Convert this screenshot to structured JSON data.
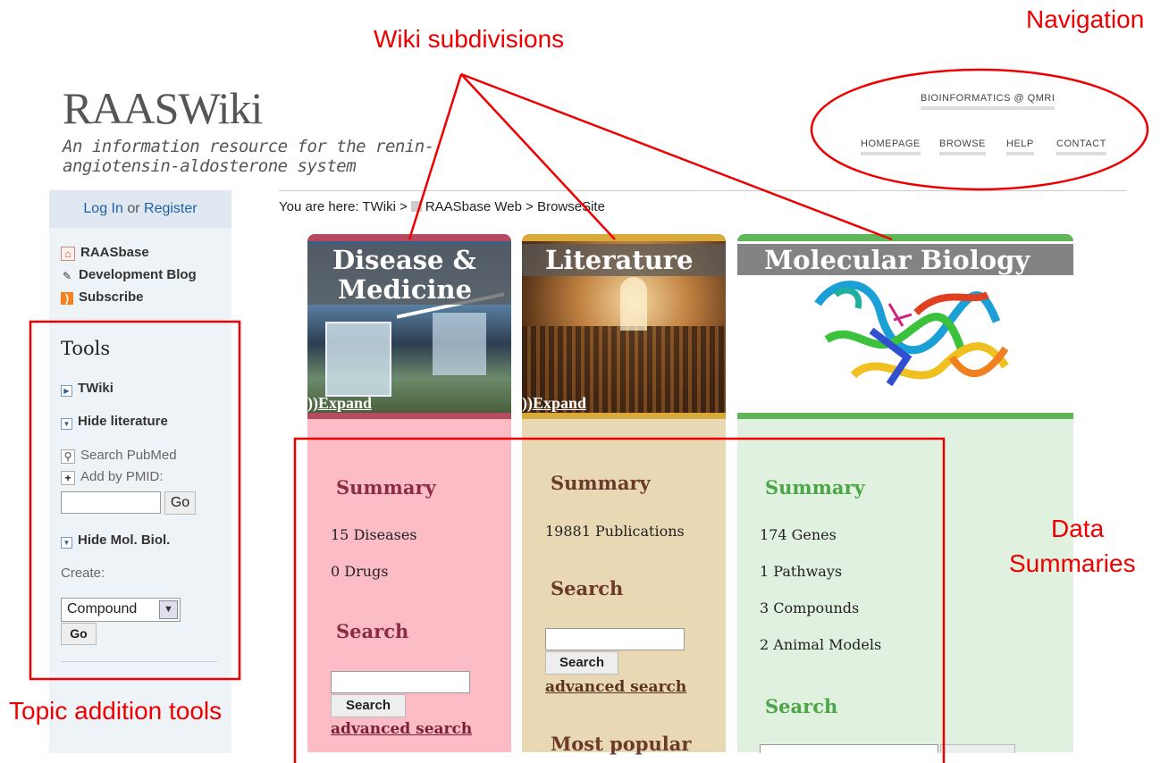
{
  "annotations": {
    "wiki_subdivisions": "Wiki subdivisions",
    "navigation": "Navigation",
    "data_summaries_line1": "Data",
    "data_summaries_line2": "Summaries",
    "topic_addition_tools": "Topic addition tools"
  },
  "colors": {
    "annotation": "#e00000",
    "link": "#1f5fa8"
  },
  "header": {
    "logo": "RAASWiki",
    "tagline": "An information resource for the renin-angiotensin-aldosterone system"
  },
  "nav": {
    "org": "BIOINFORMATICS @ QMRI",
    "items": [
      "HOMEPAGE",
      "BROWSE",
      "HELP",
      "CONTACT"
    ]
  },
  "breadcrumb": {
    "prefix": "You are here: TWiki >",
    "web": "RAASbase Web",
    "sep": ">",
    "page": "BrowseSite"
  },
  "sidebar": {
    "login": "Log In",
    "or": "or",
    "register": "Register",
    "links": [
      {
        "label": "RAASbase",
        "icon": "home-icon"
      },
      {
        "label": "Development Blog",
        "icon": "pencil-icon"
      },
      {
        "label": "Subscribe",
        "icon": "rss-icon"
      }
    ],
    "tools_title": "Tools",
    "twiki": "TWiki",
    "hide_literature": "Hide literature",
    "search_pubmed": "Search PubMed",
    "add_by_pmid": "Add by PMID:",
    "go": "Go",
    "hide_molbiol": "Hide Mol. Biol.",
    "create_label": "Create:",
    "create_select": "Compound",
    "create_go": "Go"
  },
  "panels": {
    "disease": {
      "title_line1": "Disease &",
      "title_line2": "Medicine",
      "expand": "))Expand",
      "summary": "Summary",
      "stats": [
        "15 Diseases",
        "0 Drugs"
      ],
      "search_heading": "Search",
      "search_button": "Search",
      "advanced": "advanced search"
    },
    "literature": {
      "title": "Literature",
      "expand": "))Expand",
      "summary": "Summary",
      "stats": [
        "19881 Publications"
      ],
      "search_heading": "Search",
      "search_button": "Search",
      "advanced": "advanced search",
      "most_popular": "Most popular"
    },
    "molbio": {
      "title": "Molecular Biology",
      "summary": "Summary",
      "stats": [
        "174 Genes",
        "1 Pathways",
        "3 Compounds",
        "2 Animal Models"
      ],
      "search_heading": "Search"
    }
  }
}
